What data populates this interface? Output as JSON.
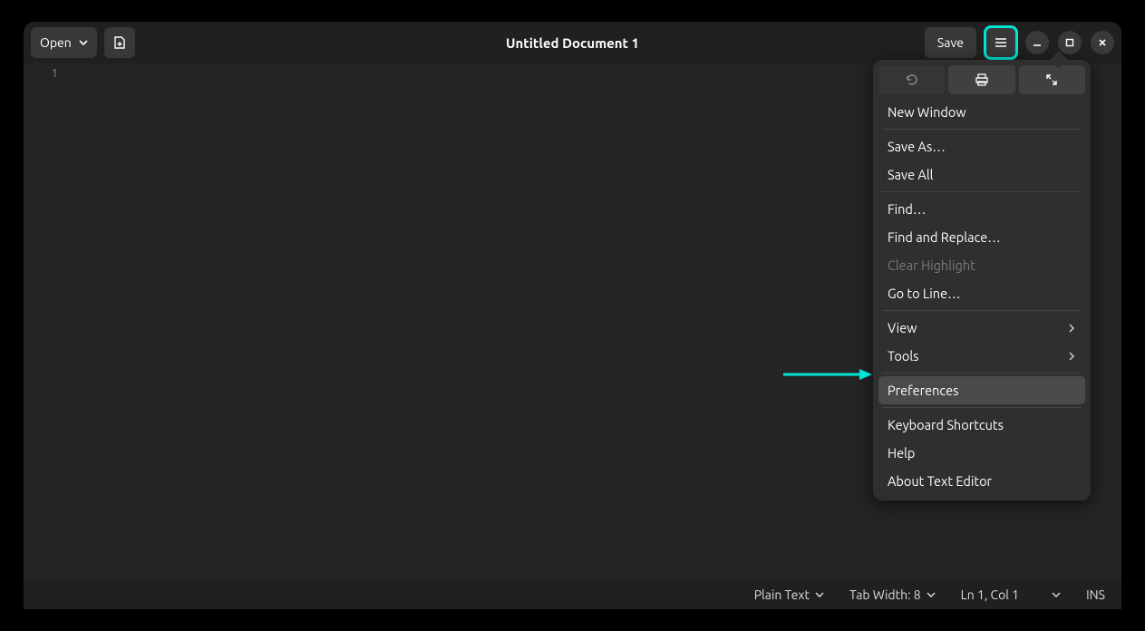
{
  "header": {
    "open_label": "Open",
    "save_label": "Save",
    "title": "Untitled Document 1"
  },
  "gutter": {
    "line1": "1"
  },
  "menu": {
    "new_window": "New Window",
    "save_as": "Save As…",
    "save_all": "Save All",
    "find": "Find…",
    "find_replace": "Find and Replace…",
    "clear_highlight": "Clear Highlight",
    "goto_line": "Go to Line…",
    "view": "View",
    "tools": "Tools",
    "preferences": "Preferences",
    "keyboard_shortcuts": "Keyboard Shortcuts",
    "help": "Help",
    "about": "About Text Editor"
  },
  "status": {
    "language": "Plain Text",
    "tab_width": "Tab Width: 8",
    "position": "Ln 1, Col 1",
    "insert_mode": "INS"
  }
}
